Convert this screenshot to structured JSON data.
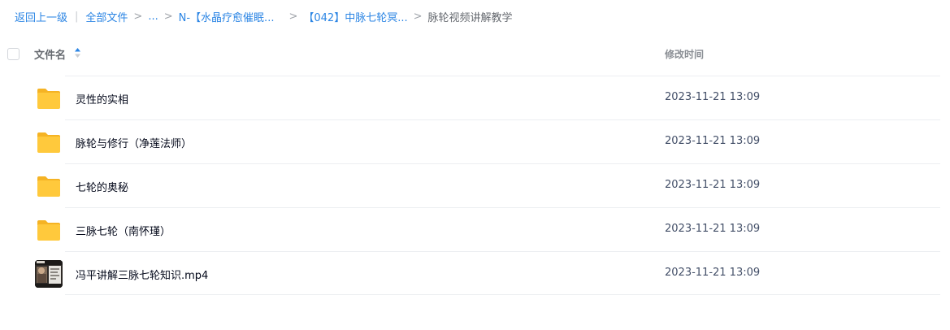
{
  "breadcrumb": {
    "back": "返回上一级",
    "all_files": "全部文件",
    "ellipsis": "...",
    "crumb1": "N-【水晶疗愈催眠...",
    "crumb2": "【042】中脉七轮冥...",
    "current": "脉轮视频讲解教学",
    "separator": ">",
    "pipe": "|"
  },
  "table": {
    "col_name": "文件名",
    "col_time": "修改时间",
    "rows": [
      {
        "name": "灵性的实相",
        "time": "2023-11-21 13:09",
        "type": "folder"
      },
      {
        "name": "脉轮与修行（净莲法师）",
        "time": "2023-11-21 13:09",
        "type": "folder"
      },
      {
        "name": "七轮的奥秘",
        "time": "2023-11-21 13:09",
        "type": "folder"
      },
      {
        "name": "三脉七轮（南怀瑾）",
        "time": "2023-11-21 13:09",
        "type": "folder"
      },
      {
        "name": "冯平讲解三脉七轮知识.mp4",
        "time": "2023-11-21 13:09",
        "type": "video"
      }
    ]
  },
  "icons": {
    "folder": "folder-icon",
    "video": "video-thumbnail",
    "sort": "sort-ascending-icon",
    "checkbox": "checkbox"
  },
  "colors": {
    "link": "#2b85e4",
    "folder": "#ffc93c",
    "sort_active": "#2b85e4"
  }
}
